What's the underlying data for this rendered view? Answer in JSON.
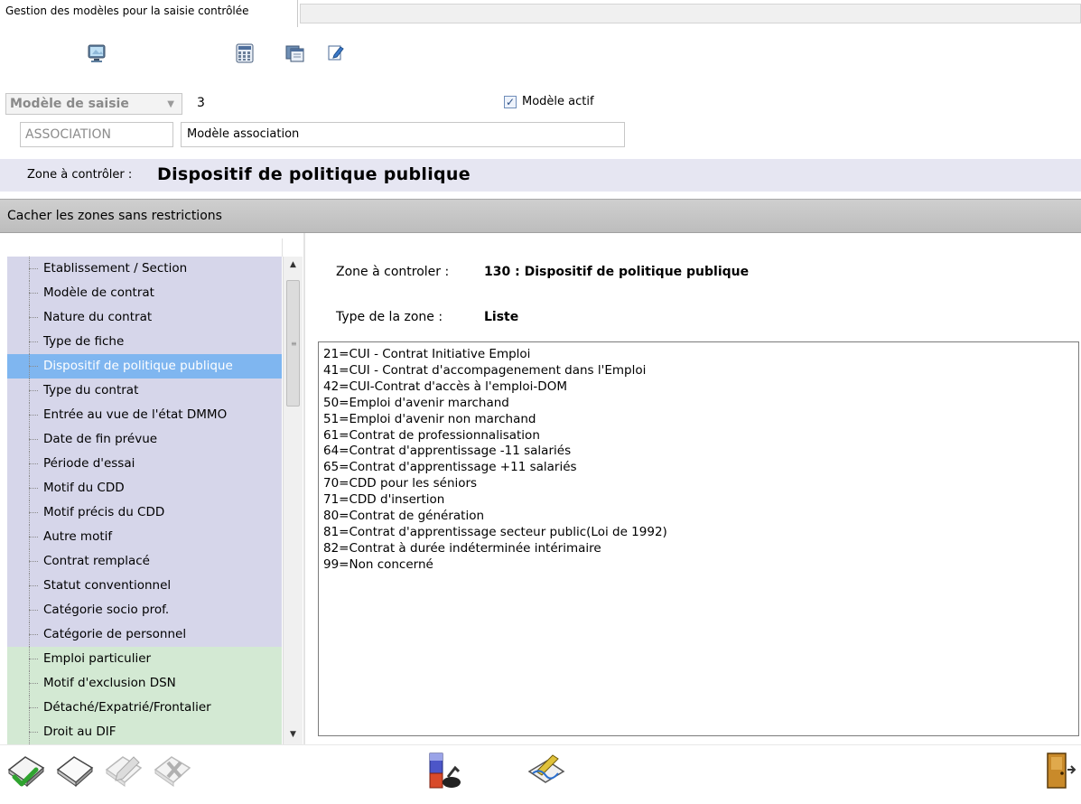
{
  "window": {
    "title": "Gestion des modèles pour la saisie contrôlée"
  },
  "toolbar": {
    "icons": [
      "monitor-icon",
      "calculator-icon",
      "window-icon",
      "edit-icon"
    ]
  },
  "model": {
    "combo_label": "Modèle de saisie",
    "number": "3",
    "active_checked": true,
    "active_label": "Modèle actif",
    "code": "ASSOCIATION",
    "description": "Modèle association"
  },
  "zone": {
    "label": "Zone à contrôler :",
    "value": "Dispositif de politique publique"
  },
  "hide_bar": {
    "label": "Cacher les zones sans restrictions"
  },
  "tree": {
    "items": [
      {
        "label": "Etablissement / Section",
        "group": "purple"
      },
      {
        "label": "Modèle de contrat",
        "group": "purple"
      },
      {
        "label": "Nature du contrat",
        "group": "purple"
      },
      {
        "label": "Type de fiche",
        "group": "purple"
      },
      {
        "label": "Dispositif de politique publique",
        "group": "selected"
      },
      {
        "label": "Type du contrat",
        "group": "purple"
      },
      {
        "label": "Entrée au vue de l'état DMMO",
        "group": "purple"
      },
      {
        "label": "Date de fin prévue",
        "group": "purple"
      },
      {
        "label": "Période d'essai",
        "group": "purple"
      },
      {
        "label": "Motif du CDD",
        "group": "purple"
      },
      {
        "label": "Motif précis du CDD",
        "group": "purple"
      },
      {
        "label": "Autre motif",
        "group": "purple"
      },
      {
        "label": "Contrat remplacé",
        "group": "purple"
      },
      {
        "label": "Statut conventionnel",
        "group": "purple"
      },
      {
        "label": "Catégorie socio prof.",
        "group": "purple"
      },
      {
        "label": "Catégorie de personnel",
        "group": "purple"
      },
      {
        "label": "Emploi particulier",
        "group": "green"
      },
      {
        "label": "Motif d'exclusion DSN",
        "group": "green"
      },
      {
        "label": "Détaché/Expatrié/Frontalier",
        "group": "green"
      },
      {
        "label": "Droit au DIF",
        "group": "green"
      }
    ]
  },
  "detail": {
    "zone_label": "Zone à controler :",
    "zone_value": "130 : Dispositif de politique publique",
    "type_label": "Type de la zone :",
    "type_value": "Liste",
    "list": [
      "21=CUI - Contrat Initiative Emploi",
      "41=CUI - Contrat d'accompagenement dans l'Emploi",
      "42=CUI-Contrat d'accès à l'emploi-DOM",
      "50=Emploi d'avenir marchand",
      "51=Emploi d'avenir non marchand",
      "61=Contrat de professionnalisation",
      "64=Contrat d'apprentissage -11 salariés",
      "65=Contrat d'apprentissage +11 salariés",
      "70=CDD pour les séniors",
      "71=CDD d'insertion",
      "80=Contrat de génération",
      "81=Contrat d'apprentissage secteur public(Loi de 1992)",
      "82=Contrat à durée indéterminée intérimaire",
      "99=Non concerné"
    ]
  },
  "bottom_bar": {
    "icons": [
      "validate-icon",
      "eraser-icon",
      "edit-disabled-icon",
      "delete-disabled-icon",
      "test-tube-icon",
      "sign-icon",
      "exit-door-icon"
    ]
  },
  "colors": {
    "tree_purple": "#d6d6ea",
    "tree_green": "#d3e9d3",
    "tree_selected": "#7fb6f0",
    "zone_band": "#e6e6f2"
  }
}
